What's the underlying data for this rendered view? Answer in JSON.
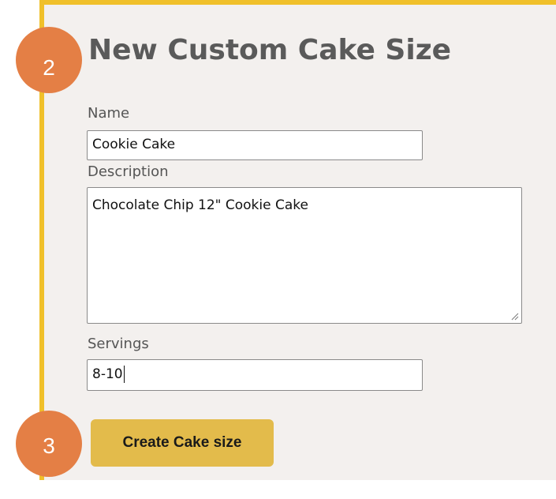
{
  "steps": {
    "step_two": "2",
    "step_three": "3"
  },
  "form": {
    "title": "New Custom Cake Size",
    "name_label": "Name",
    "name_value": "Cookie Cake",
    "description_label": "Description",
    "description_value": "Chocolate Chip 12\" Cookie Cake",
    "servings_label": "Servings",
    "servings_value": "8-10",
    "submit_label": "Create Cake size"
  },
  "colors": {
    "panel_border": "#f0c02a",
    "panel_background": "#f3f0ee",
    "button_background": "#e3bb4b",
    "step_badge": "#e47f45"
  },
  "icons": {
    "textarea_resize": "resize-grip-icon"
  }
}
